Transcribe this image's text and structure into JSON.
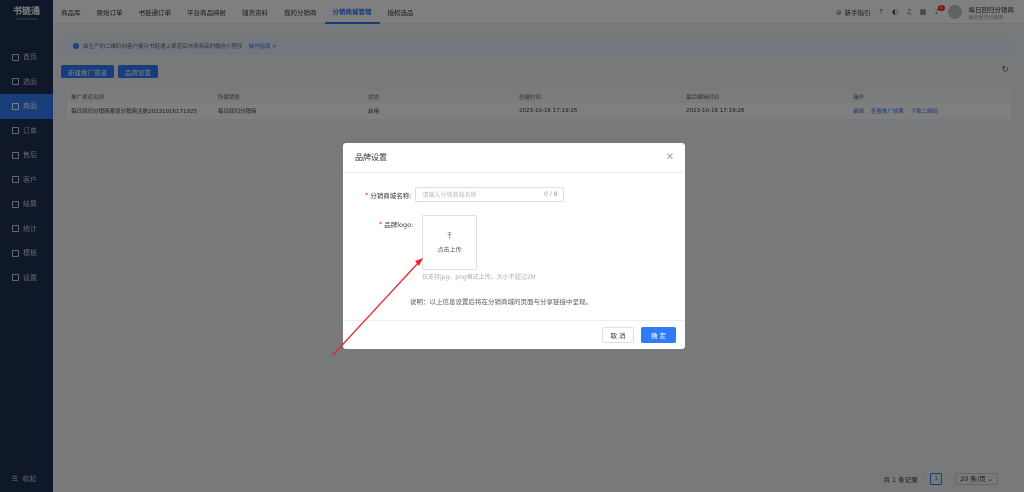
{
  "sidebar": {
    "logo_title": "书链通",
    "logo_sub": "SHULIANTONG",
    "items": [
      {
        "label": "首页"
      },
      {
        "label": "选品"
      },
      {
        "label": "商品"
      },
      {
        "label": "订单"
      },
      {
        "label": "售后"
      },
      {
        "label": "客户"
      },
      {
        "label": "结算"
      },
      {
        "label": "统计"
      },
      {
        "label": "模板"
      },
      {
        "label": "设置"
      }
    ],
    "collapse_label": "收起"
  },
  "topbar": {
    "tabs": [
      "商品库",
      "原始订单",
      "书链通订单",
      "平台商品映射",
      "铺货资料",
      "我的分销商",
      "分销商城管理",
      "授权选品"
    ],
    "guide_label": "新手指引",
    "notify_count": "6",
    "user_name": "每日回归分销商",
    "user_role": "每日回归分销商"
  },
  "main": {
    "notice_text": "由生产的二维码向客户展示书链通上渠道后市场商品的微信小程序",
    "notice_link": "操作指南 >",
    "btn_new": "新建推广渠道",
    "btn_brand": "品牌设置",
    "table": {
      "headers": [
        "推广渠道名称",
        "所属销售",
        "状态",
        "创建时间",
        "最后编辑时间",
        "操作"
      ],
      "rows": [
        {
          "name": "每日回归分销商渠道分销商注册20231016171925",
          "sales": "每日回归分销商",
          "status": "启用",
          "created": "2023-10-16 17:19:25",
          "edited": "2023-10-16 17:19:26",
          "actions": [
            "编辑",
            "查看推广效果",
            "下载二维码"
          ]
        }
      ]
    },
    "pager": {
      "total": "共 1 条记录",
      "page": "1",
      "size": "20 条/页"
    }
  },
  "modal": {
    "title": "品牌设置",
    "field_name_label": "分销商城名称:",
    "field_name_placeholder": "请输入分销商城名称",
    "field_name_count": "0 / 8",
    "field_logo_label": "品牌logo:",
    "upload_label": "点击上传",
    "upload_hint": "仅支持jpg、png格式上传，大小不超过2M",
    "note": "说明：以上信息设置后将在分销商城的页面与分享链接中呈现。",
    "cancel": "取 消",
    "ok": "确 定"
  },
  "colors": {
    "primary": "#2f7cf6",
    "sidebar": "#1f3150",
    "annotation": "#e8252b"
  }
}
